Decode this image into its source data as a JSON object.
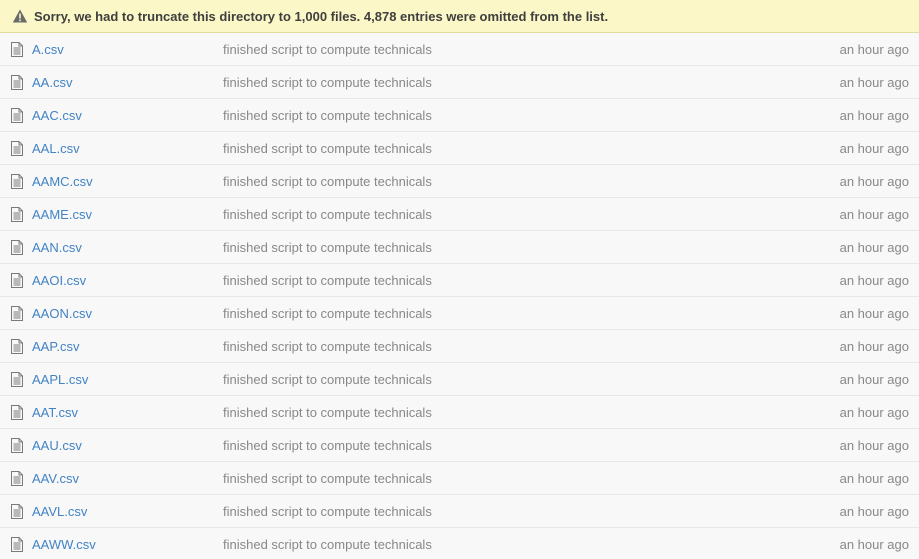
{
  "flash": {
    "message": "Sorry, we had to truncate this directory to 1,000 files. 4,878 entries were omitted from the list."
  },
  "files": [
    {
      "name": "A.csv",
      "message": "finished script to compute technicals",
      "age": "an hour ago"
    },
    {
      "name": "AA.csv",
      "message": "finished script to compute technicals",
      "age": "an hour ago"
    },
    {
      "name": "AAC.csv",
      "message": "finished script to compute technicals",
      "age": "an hour ago"
    },
    {
      "name": "AAL.csv",
      "message": "finished script to compute technicals",
      "age": "an hour ago"
    },
    {
      "name": "AAMC.csv",
      "message": "finished script to compute technicals",
      "age": "an hour ago"
    },
    {
      "name": "AAME.csv",
      "message": "finished script to compute technicals",
      "age": "an hour ago"
    },
    {
      "name": "AAN.csv",
      "message": "finished script to compute technicals",
      "age": "an hour ago"
    },
    {
      "name": "AAOI.csv",
      "message": "finished script to compute technicals",
      "age": "an hour ago"
    },
    {
      "name": "AAON.csv",
      "message": "finished script to compute technicals",
      "age": "an hour ago"
    },
    {
      "name": "AAP.csv",
      "message": "finished script to compute technicals",
      "age": "an hour ago"
    },
    {
      "name": "AAPL.csv",
      "message": "finished script to compute technicals",
      "age": "an hour ago"
    },
    {
      "name": "AAT.csv",
      "message": "finished script to compute technicals",
      "age": "an hour ago"
    },
    {
      "name": "AAU.csv",
      "message": "finished script to compute technicals",
      "age": "an hour ago"
    },
    {
      "name": "AAV.csv",
      "message": "finished script to compute technicals",
      "age": "an hour ago"
    },
    {
      "name": "AAVL.csv",
      "message": "finished script to compute technicals",
      "age": "an hour ago"
    },
    {
      "name": "AAWW.csv",
      "message": "finished script to compute technicals",
      "age": "an hour ago"
    }
  ],
  "colors": {
    "link": "#4183c4",
    "muted": "#888888",
    "flash_bg": "#fbf7c7"
  },
  "icons": {
    "flash": "warning-icon",
    "file": "file-text-icon"
  }
}
